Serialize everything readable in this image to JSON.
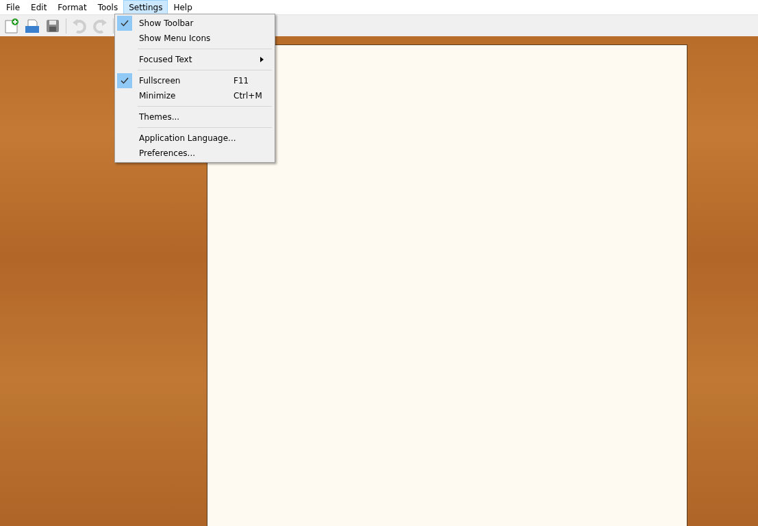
{
  "menubar": [
    {
      "label": "File",
      "selected": false
    },
    {
      "label": "Edit",
      "selected": false
    },
    {
      "label": "Format",
      "selected": false
    },
    {
      "label": "Tools",
      "selected": false
    },
    {
      "label": "Settings",
      "selected": true
    },
    {
      "label": "Help",
      "selected": false
    }
  ],
  "toolbar": [
    {
      "kind": "new",
      "disabled": false
    },
    {
      "kind": "open",
      "disabled": false
    },
    {
      "kind": "save",
      "disabled": false
    },
    {
      "kind": "separator"
    },
    {
      "kind": "undo",
      "disabled": true
    },
    {
      "kind": "redo",
      "disabled": true
    },
    {
      "kind": "separator"
    }
  ],
  "menu": [
    {
      "kind": "item",
      "label": "Show Toolbar",
      "checked": true
    },
    {
      "kind": "item",
      "label": "Show Menu Icons",
      "checked": false
    },
    {
      "kind": "separator"
    },
    {
      "kind": "submenu",
      "label": "Focused Text",
      "checked": false
    },
    {
      "kind": "separator"
    },
    {
      "kind": "item",
      "label": "Fullscreen",
      "checked": true,
      "shortcut": "F11"
    },
    {
      "kind": "item",
      "label": "Minimize",
      "checked": false,
      "shortcut": "Ctrl+M"
    },
    {
      "kind": "separator"
    },
    {
      "kind": "item",
      "label": "Themes...",
      "checked": false
    },
    {
      "kind": "separator"
    },
    {
      "kind": "item",
      "label": "Application Language...",
      "checked": false
    },
    {
      "kind": "item",
      "label": "Preferences...",
      "checked": false
    }
  ]
}
